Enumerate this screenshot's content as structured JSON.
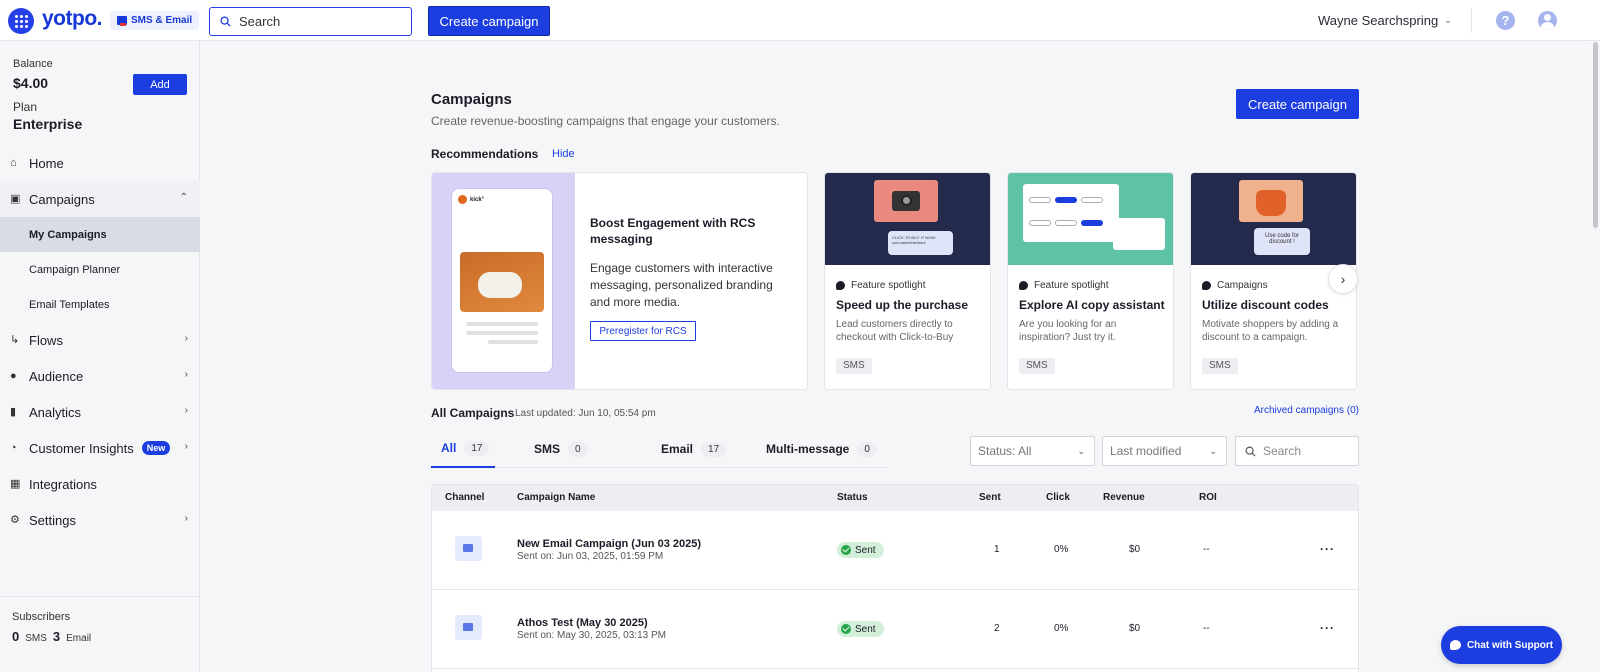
{
  "topbar": {
    "logo": "yotpo.",
    "product": "SMS & Email",
    "search_placeholder": "Search",
    "create_button": "Create campaign",
    "account_name": "Wayne Searchspring",
    "help": "?"
  },
  "sidebar": {
    "balance_label": "Balance",
    "balance_value": "$4.00",
    "add_button": "Add",
    "plan_label": "Plan",
    "plan_value": "Enterprise",
    "items": {
      "home": "Home",
      "campaigns": "Campaigns",
      "my_campaigns": "My Campaigns",
      "campaign_planner": "Campaign Planner",
      "email_templates": "Email Templates",
      "flows": "Flows",
      "audience": "Audience",
      "analytics": "Analytics",
      "customer_insights": "Customer Insights",
      "new_badge": "New",
      "integrations": "Integrations",
      "settings": "Settings"
    },
    "subscribers": {
      "label": "Subscribers",
      "sms_count": "0",
      "sms_label": "SMS",
      "email_count": "3",
      "email_label": "Email"
    }
  },
  "page": {
    "title": "Campaigns",
    "subtitle": "Create revenue-boosting campaigns that engage your customers.",
    "create_button": "Create campaign",
    "recommendations_label": "Recommendations",
    "hide_link": "Hide"
  },
  "rcs_card": {
    "brand": "kick°",
    "title": "Boost Engagement with RCS messaging",
    "description": "Engage customers with interactive messaging, personalized branding and more media.",
    "button": "Preregister for RCS"
  },
  "features": [
    {
      "kind": "Feature spotlight",
      "title": "Speed up the purchase",
      "description": "Lead customers directly to checkout with Click-to-Buy",
      "tag": "SMS",
      "bg": "#232a4b",
      "img_text": "CLICK TO BUY IT NOW: com.ame/checkout"
    },
    {
      "kind": "Feature spotlight",
      "title": "Explore AI copy assistant",
      "description": "Are you looking for an inspiration? Just try it.",
      "tag": "SMS",
      "bg": "#5ec2a6",
      "img_text": ""
    },
    {
      "kind": "Campaigns",
      "title": "Utilize discount codes",
      "description": "Motivate shoppers by adding a discount to a campaign.",
      "tag": "SMS",
      "bg": "#232a4b",
      "img_text": "Use code for discount !"
    }
  ],
  "all_campaigns": {
    "title": "All Campaigns",
    "last_updated": "Last updated: Jun 10, 05:54 pm",
    "archived_link": "Archived campaigns (0)",
    "tabs": [
      {
        "label": "All",
        "count": "17"
      },
      {
        "label": "SMS",
        "count": "0"
      },
      {
        "label": "Email",
        "count": "17"
      },
      {
        "label": "Multi-message",
        "count": "0"
      }
    ],
    "status_filter": "Status: All",
    "sort_filter": "Last modified",
    "search_placeholder": "Search"
  },
  "table": {
    "columns": [
      "Channel",
      "Campaign Name",
      "Status",
      "Sent",
      "Click",
      "Revenue",
      "ROI"
    ],
    "rows": [
      {
        "name": "New Email Campaign (Jun 03 2025)",
        "sent_on": "Sent on: Jun 03, 2025, 01:59 PM",
        "status": "Sent",
        "sent": "1",
        "click": "0%",
        "revenue": "$0",
        "roi": "--"
      },
      {
        "name": "Athos Test (May 30 2025)",
        "sent_on": "Sent on: May 30, 2025, 03:13 PM",
        "status": "Sent",
        "sent": "2",
        "click": "0%",
        "revenue": "$0",
        "roi": "--"
      }
    ]
  },
  "chat_button": "Chat with Support"
}
